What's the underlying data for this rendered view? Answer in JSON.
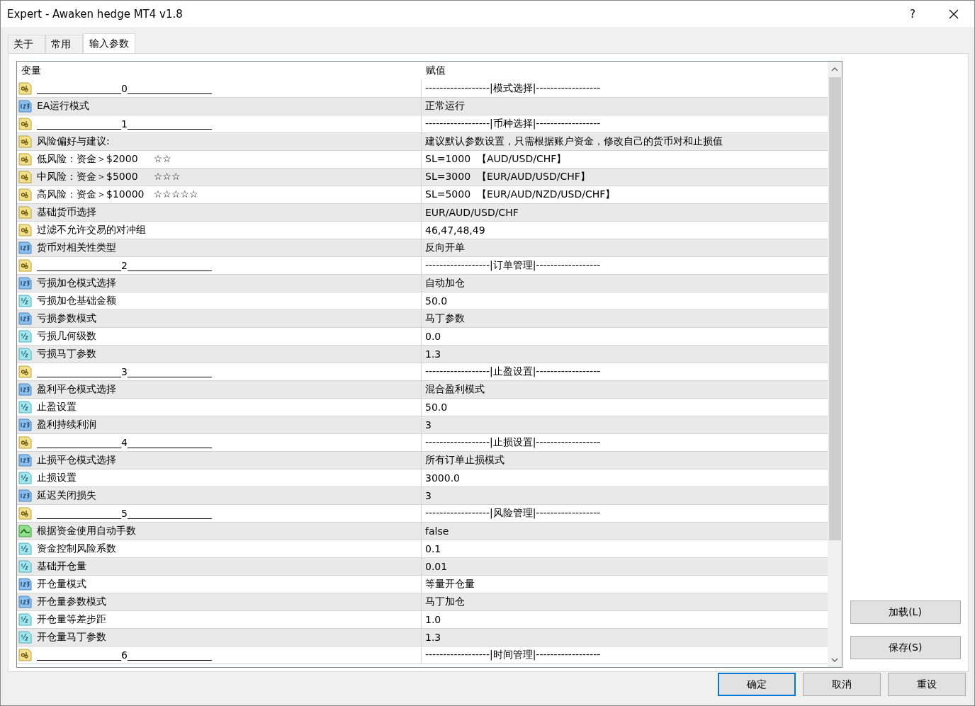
{
  "window": {
    "title": "Expert - Awaken hedge MT4 v1.8",
    "help": "?"
  },
  "tabs": [
    {
      "label": "关于",
      "selected": false
    },
    {
      "label": "常用",
      "selected": false
    },
    {
      "label": "输入参数",
      "selected": true
    }
  ],
  "table": {
    "columns": [
      "变量",
      "赋值"
    ],
    "rows": [
      {
        "kind": "string",
        "variable": "_________________0_________________",
        "value": "------------------|模式选择|------------------"
      },
      {
        "kind": "int",
        "variable": "EA运行模式",
        "value": "正常运行"
      },
      {
        "kind": "string",
        "variable": "_________________1_________________",
        "value": "------------------|币种选择|------------------"
      },
      {
        "kind": "string",
        "variable": "风险偏好与建议:",
        "value": "建议默认参数设置，只需根据账户资金，修改自己的货币对和止损值"
      },
      {
        "kind": "string",
        "variable": "低风险：资金＞$2000     ☆☆",
        "value": "SL=1000  【AUD/USD/CHF】"
      },
      {
        "kind": "string",
        "variable": "中风险：资金＞$5000     ☆☆☆",
        "value": "SL=3000  【EUR/AUD/USD/CHF】"
      },
      {
        "kind": "string",
        "variable": "高风险：资金＞$10000   ☆☆☆☆☆",
        "value": "SL=5000  【EUR/AUD/NZD/USD/CHF】"
      },
      {
        "kind": "string",
        "variable": "基础货币选择",
        "value": "EUR/AUD/USD/CHF"
      },
      {
        "kind": "string",
        "variable": "过滤不允许交易的对冲组",
        "value": "46,47,48,49"
      },
      {
        "kind": "int",
        "variable": "货币对相关性类型",
        "value": "反向开单"
      },
      {
        "kind": "string",
        "variable": "_________________2_________________",
        "value": "------------------|订单管理|------------------"
      },
      {
        "kind": "int",
        "variable": "亏损加仓模式选择",
        "value": "自动加仓"
      },
      {
        "kind": "double",
        "variable": "亏损加仓基础金额",
        "value": "50.0"
      },
      {
        "kind": "int",
        "variable": "亏损参数模式",
        "value": "马丁参数"
      },
      {
        "kind": "double",
        "variable": "亏损几何级数",
        "value": "0.0"
      },
      {
        "kind": "double",
        "variable": "亏损马丁参数",
        "value": "1.3"
      },
      {
        "kind": "string",
        "variable": "_________________3_________________",
        "value": "------------------|止盈设置|------------------"
      },
      {
        "kind": "int",
        "variable": "盈利平仓模式选择",
        "value": "混合盈利模式"
      },
      {
        "kind": "double",
        "variable": "止盈设置",
        "value": "50.0"
      },
      {
        "kind": "int",
        "variable": "盈利持续利润",
        "value": "3"
      },
      {
        "kind": "string",
        "variable": "_________________4_________________",
        "value": "------------------|止损设置|------------------"
      },
      {
        "kind": "int",
        "variable": "止损平仓模式选择",
        "value": "所有订单止损模式"
      },
      {
        "kind": "double",
        "variable": "止损设置",
        "value": "3000.0"
      },
      {
        "kind": "int",
        "variable": "延迟关闭损失",
        "value": "3"
      },
      {
        "kind": "string",
        "variable": "_________________5_________________",
        "value": "------------------|风险管理|------------------"
      },
      {
        "kind": "bool",
        "variable": "根据资金使用自动手数",
        "value": "false"
      },
      {
        "kind": "double",
        "variable": "资金控制风险系数",
        "value": "0.1"
      },
      {
        "kind": "double",
        "variable": "基础开仓量",
        "value": "0.01"
      },
      {
        "kind": "int",
        "variable": "开仓量模式",
        "value": "等量开仓量"
      },
      {
        "kind": "int",
        "variable": "开仓量参数模式",
        "value": "马丁加仓"
      },
      {
        "kind": "double",
        "variable": "开仓量等差步距",
        "value": "1.0"
      },
      {
        "kind": "double",
        "variable": "开仓量马丁参数",
        "value": "1.3"
      },
      {
        "kind": "string",
        "variable": "_________________6_________________",
        "value": "------------------|时间管理|------------------"
      }
    ]
  },
  "side_buttons": [
    "加载(L)",
    "保存(S)"
  ],
  "buttons": [
    {
      "label": "确定",
      "default": true
    },
    {
      "label": "取消",
      "default": false
    },
    {
      "label": "重设",
      "default": false
    }
  ]
}
